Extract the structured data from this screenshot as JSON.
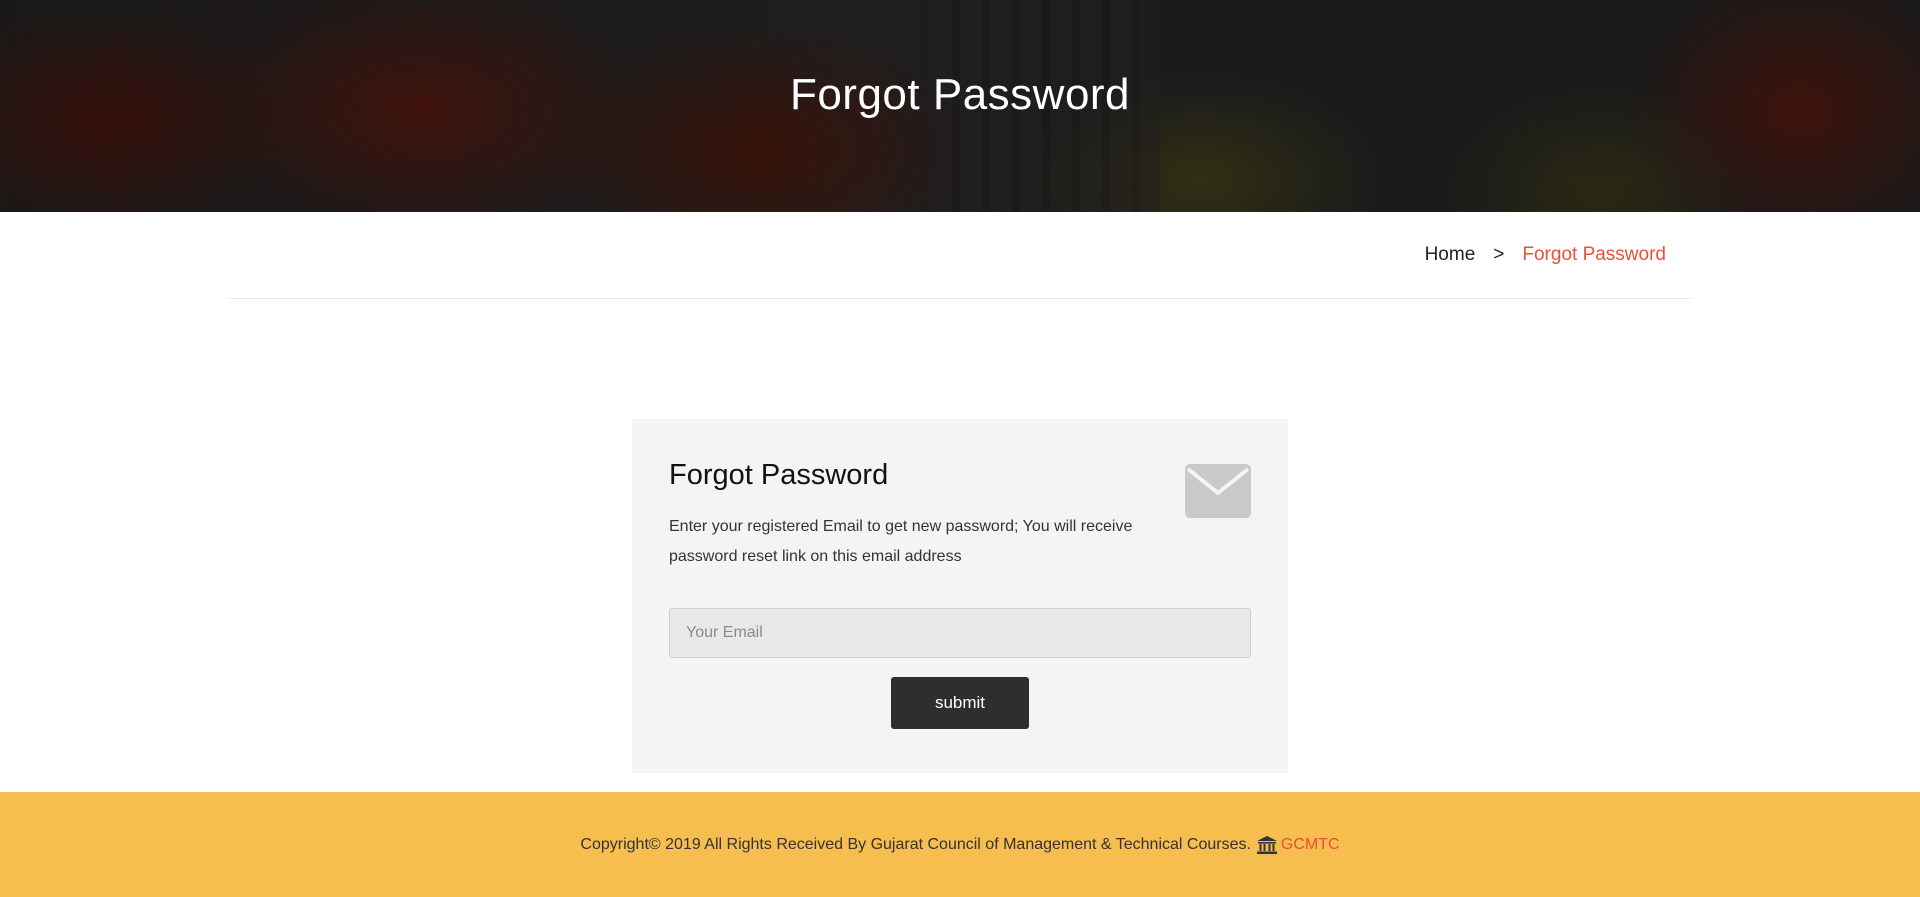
{
  "hero": {
    "title": "Forgot Password"
  },
  "breadcrumb": {
    "home": "Home",
    "separator": ">",
    "current": "Forgot Password"
  },
  "card": {
    "title": "Forgot Password",
    "description": "Enter your registered Email to get new password; You will receive password reset link on this email address",
    "icon": "envelope-icon",
    "email_placeholder": "Your Email",
    "email_value": "",
    "submit_label": "submit"
  },
  "footer": {
    "copyright": "Copyright© 2019 All Rights Received By Gujarat Council of Management & Technical Courses.",
    "icon": "bank-icon",
    "brand": "GCMTC"
  },
  "colors": {
    "accent": "#e8503a",
    "footer_bg": "#f6bd4f",
    "button_bg": "#2e2e2e",
    "card_bg": "#f4f4f4"
  }
}
